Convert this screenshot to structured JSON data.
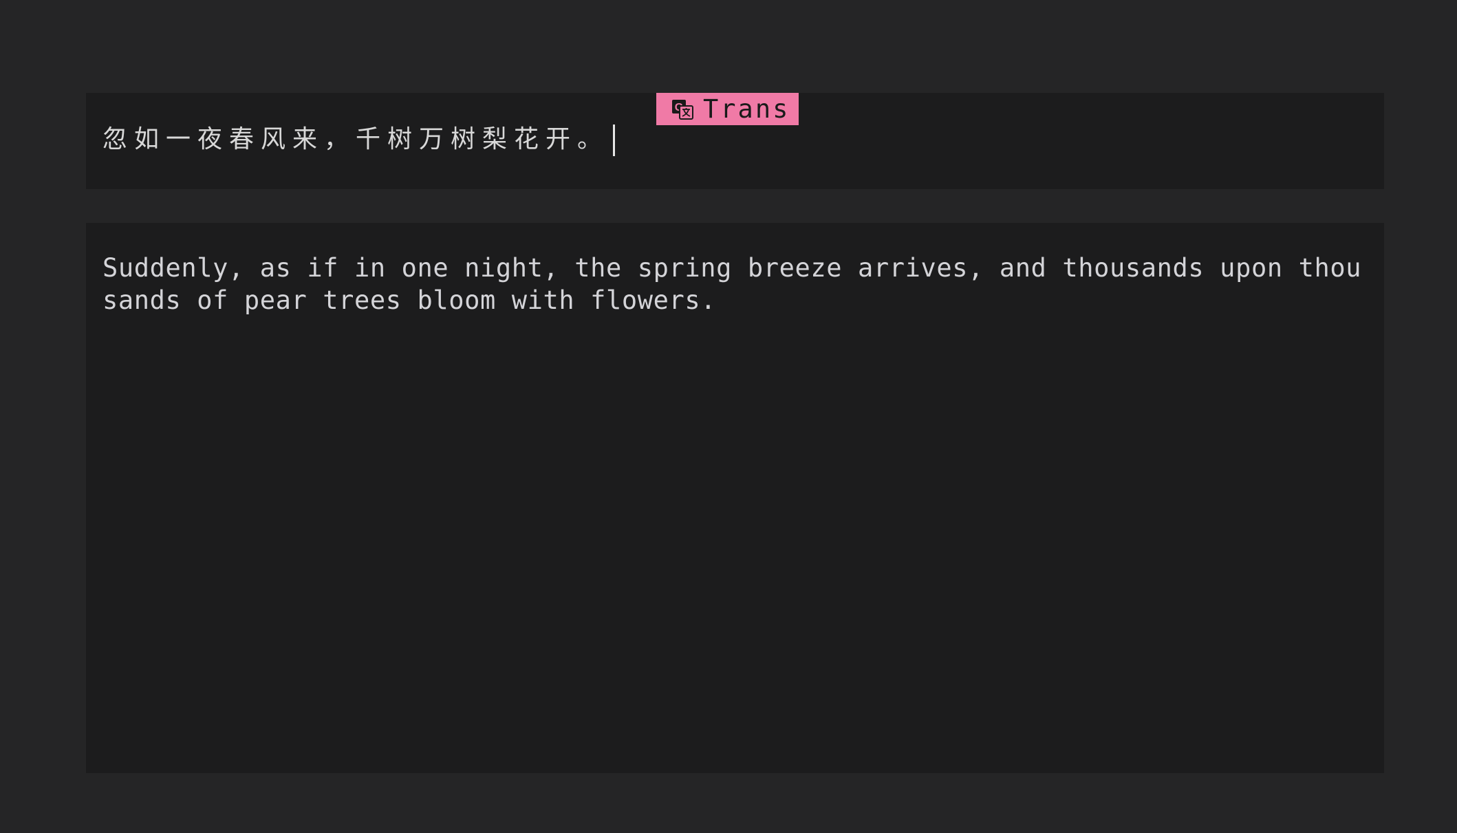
{
  "input": {
    "text": "忽如一夜春风来，千树万树梨花开。"
  },
  "toolbar": {
    "translate_label": "Trans",
    "translate_icon": "translate-icon",
    "accent_color": "#f07aa6"
  },
  "output": {
    "text": "Suddenly, as if in one night, the spring breeze arrives, and thousands upon thousands of pear trees bloom with flowers."
  }
}
